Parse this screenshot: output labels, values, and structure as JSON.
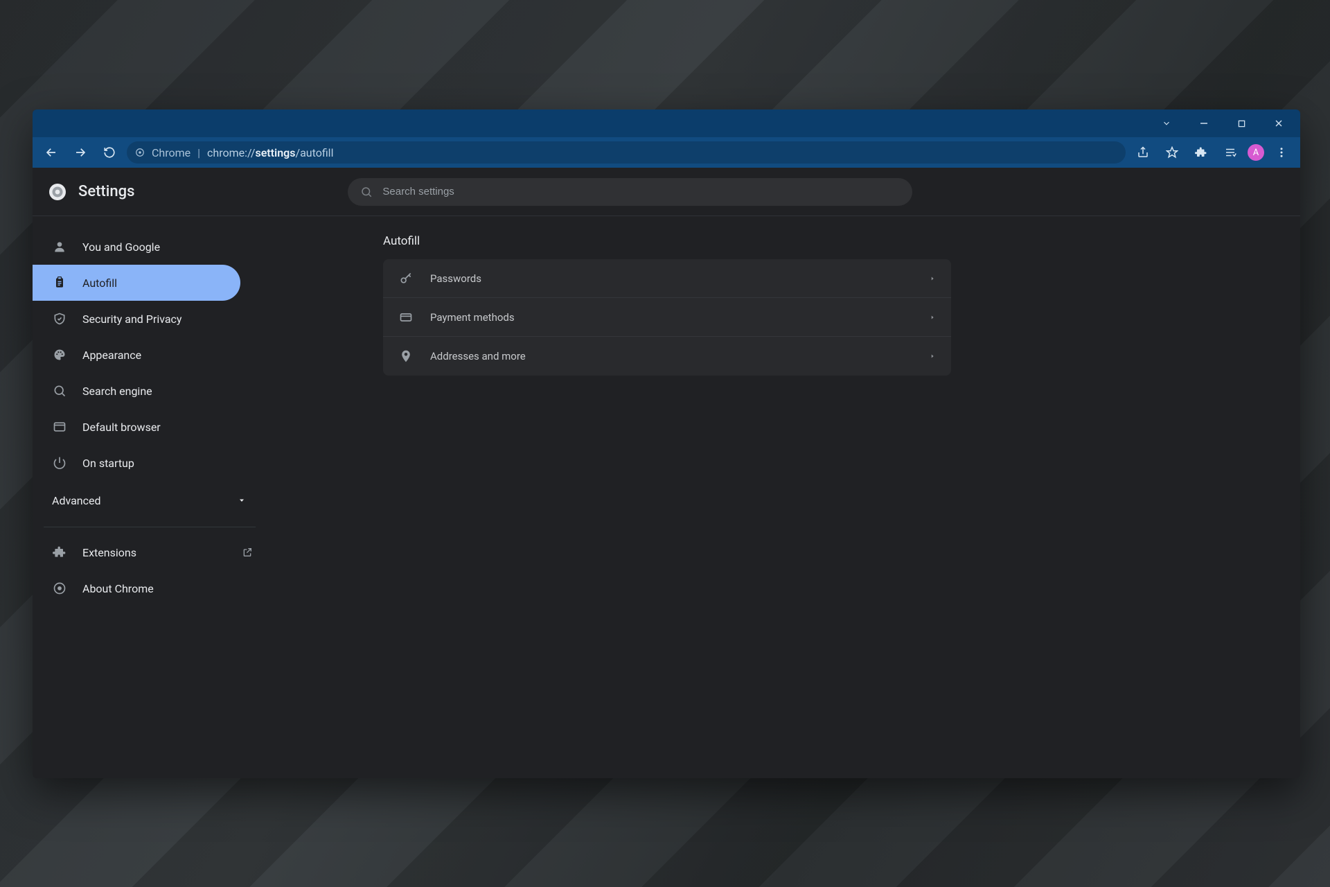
{
  "window": {
    "titlebar": {},
    "toolbar": {
      "secure_label": "Chrome",
      "url_prefix": "chrome://",
      "url_bold": "settings",
      "url_suffix": "/autofill",
      "avatar_initial": "A"
    }
  },
  "header": {
    "title": "Settings",
    "search_placeholder": "Search settings"
  },
  "sidebar": {
    "items": [
      {
        "label": "You and Google",
        "icon": "person-icon"
      },
      {
        "label": "Autofill",
        "icon": "clipboard-icon",
        "active": true
      },
      {
        "label": "Security and Privacy",
        "icon": "shield-icon"
      },
      {
        "label": "Appearance",
        "icon": "palette-icon"
      },
      {
        "label": "Search engine",
        "icon": "search-icon"
      },
      {
        "label": "Default browser",
        "icon": "browser-icon"
      },
      {
        "label": "On startup",
        "icon": "power-icon"
      }
    ],
    "advanced_label": "Advanced",
    "footer": [
      {
        "label": "Extensions",
        "icon": "puzzle-icon",
        "external": true
      },
      {
        "label": "About Chrome",
        "icon": "chrome-icon"
      }
    ]
  },
  "main": {
    "section_title": "Autofill",
    "rows": [
      {
        "label": "Passwords",
        "icon": "key-icon"
      },
      {
        "label": "Payment methods",
        "icon": "card-icon"
      },
      {
        "label": "Addresses and more",
        "icon": "pin-icon"
      }
    ]
  }
}
